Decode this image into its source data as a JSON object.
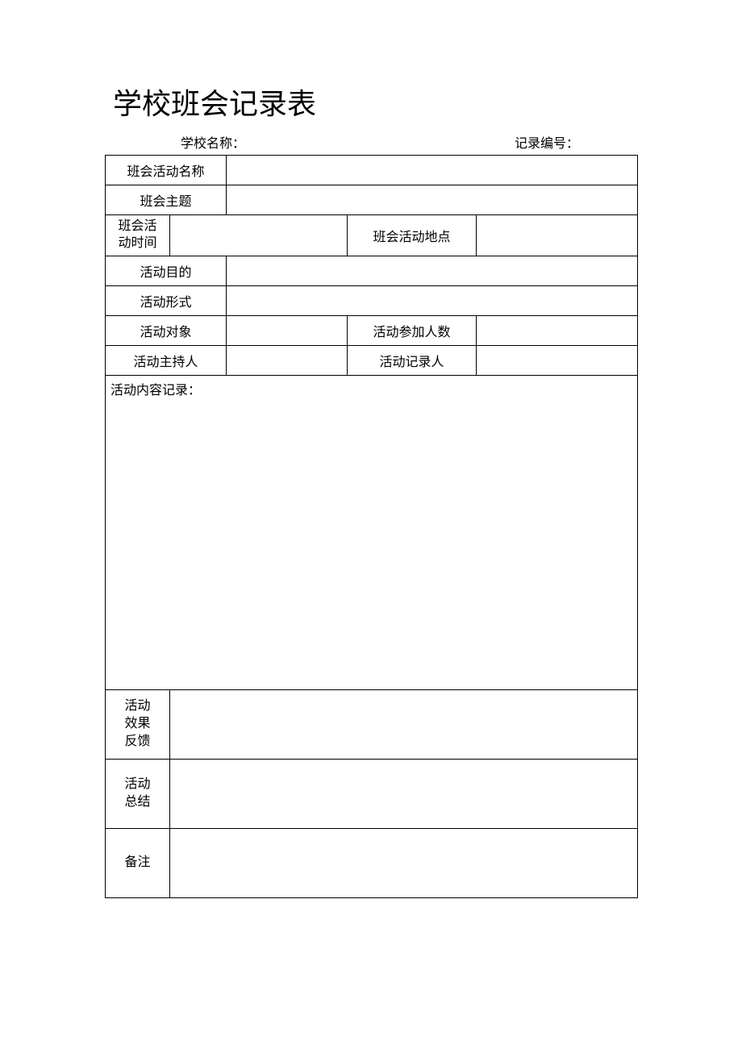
{
  "title": "学校班会记录表",
  "header": {
    "school_label": "学校名称：",
    "school_value": "",
    "record_no_label": "记录编号：",
    "record_no_value": ""
  },
  "labels": {
    "activity_name": "班会活动名称",
    "topic": "班会主题",
    "activity_time": "班会活动时间",
    "activity_location": "班会活动地点",
    "purpose": "活动目的",
    "form": "活动形式",
    "target": "活动对象",
    "participants": "活动参加人数",
    "host": "活动主持人",
    "recorder": "活动记录人",
    "content": "活动内容记录：",
    "feedback": "活动效果反馈",
    "summary": "活动总结",
    "remark": "备注"
  },
  "values": {
    "activity_name": "",
    "topic": "",
    "activity_time": "",
    "activity_location": "",
    "purpose": "",
    "form": "",
    "target": "",
    "participants": "",
    "host": "",
    "recorder": "",
    "content": "",
    "feedback": "",
    "summary": "",
    "remark": ""
  }
}
